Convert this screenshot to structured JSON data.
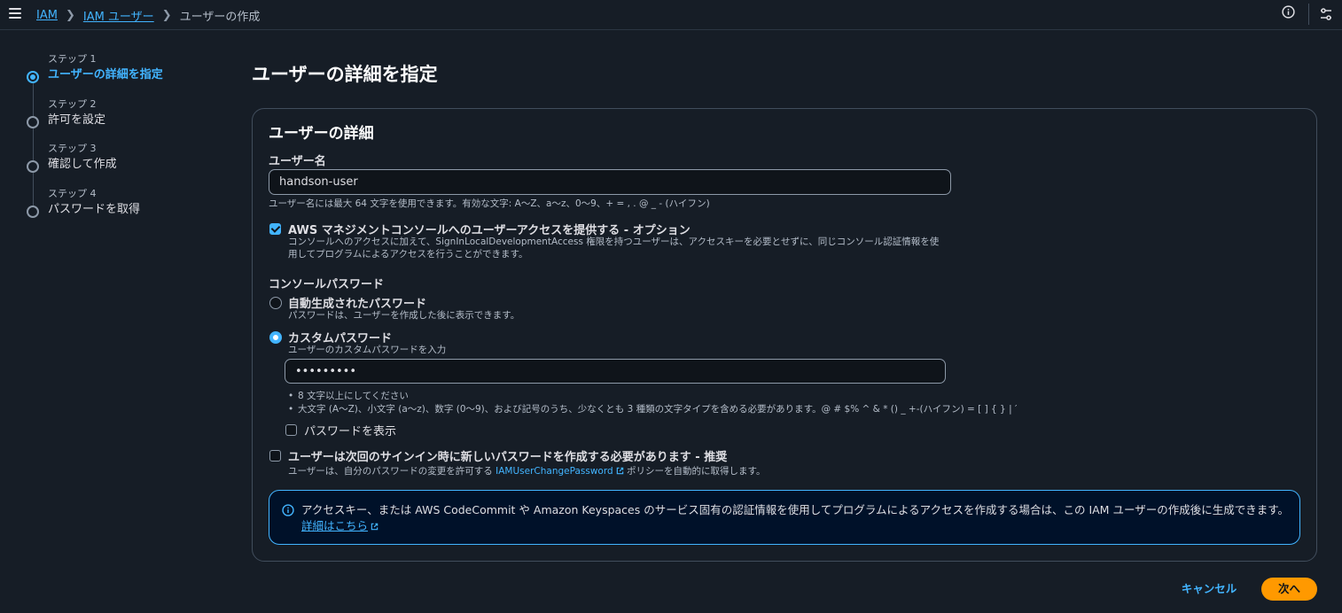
{
  "breadcrumb": {
    "items": [
      {
        "label": "IAM",
        "link": true
      },
      {
        "label": "IAM ユーザー",
        "link": true
      },
      {
        "label": "ユーザーの作成",
        "link": false
      }
    ]
  },
  "steps": [
    {
      "number": "ステップ 1",
      "label": "ユーザーの詳細を指定",
      "active": true
    },
    {
      "number": "ステップ 2",
      "label": "許可を設定",
      "active": false
    },
    {
      "number": "ステップ 3",
      "label": "確認して作成",
      "active": false
    },
    {
      "number": "ステップ 4",
      "label": "パスワードを取得",
      "active": false
    }
  ],
  "page": {
    "title": "ユーザーの詳細を指定"
  },
  "panel": {
    "title": "ユーザーの詳細",
    "username_label": "ユーザー名",
    "username_value": "handson-user",
    "username_hint": "ユーザー名には最大 64 文字を使用できます。有効な文字: A〜Z、a〜z、0〜9、+ = , . @ _ - (ハイフン)",
    "console_access_label": "AWS マネジメントコンソールへのユーザーアクセスを提供する - オプション",
    "console_access_checked": true,
    "console_access_desc_1": "コンソールへのアクセスに加えて、SignInLocalDevelopmentAccess 権限を持つユーザーは、アクセスキーを必要とせずに、同じコンソール認証情報を使",
    "console_access_desc_2": "用してプログラムによるアクセスを行うことができます。",
    "console_password_label": "コンソールパスワード",
    "auto_password_label": "自動生成されたパスワード",
    "auto_password_desc": "パスワードは、ユーザーを作成した後に表示できます。",
    "custom_password_label": "カスタムパスワード",
    "custom_password_desc": "ユーザーのカスタムパスワードを入力",
    "custom_password_value": "•••••••••",
    "password_rules": [
      "8 文字以上にしてください",
      "大文字 (A〜Z)、小文字 (a〜z)、数字 (0〜9)、および記号のうち、少なくとも 3 種類の文字タイプを含める必要があります。@ # $% ^ & * () _ +-(ハイフン) = [ ] { } | ′"
    ],
    "show_password_label": "パスワードを表示",
    "require_reset_label": "ユーザーは次回のサインイン時に新しいパスワードを作成する必要があります - 推奨",
    "require_reset_desc_prefix": "ユーザーは、自分のパスワードの変更を許可する",
    "require_reset_link": "IAMUserChangePassword",
    "require_reset_desc_suffix": "ポリシーを自動的に取得します。"
  },
  "info_box": {
    "text": "アクセスキー、または AWS CodeCommit や Amazon Keyspaces のサービス固有の認証情報を使用してプログラムによるアクセスを作成する場合は、この IAM ユーザーの作成後に生成できます。",
    "link": "詳細はこちら"
  },
  "actions": {
    "cancel": "キャンセル",
    "next": "次へ"
  },
  "colors": {
    "background": "#161d26",
    "accent": "#42b4ff",
    "primary_button": "#ff9900"
  }
}
